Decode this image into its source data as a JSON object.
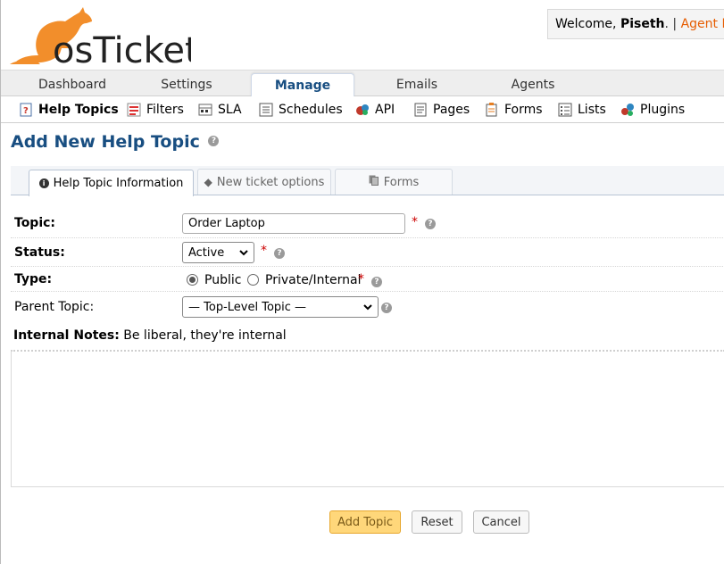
{
  "header": {
    "logo_text": "osTicket",
    "welcome_prefix": "Welcome,",
    "username": "Piseth",
    "separator": ". |",
    "agent_panel_link": "Agent Panel"
  },
  "main_nav": {
    "tabs": [
      {
        "label": "Dashboard",
        "active": false
      },
      {
        "label": "Settings",
        "active": false
      },
      {
        "label": "Manage",
        "active": true
      },
      {
        "label": "Emails",
        "active": false
      },
      {
        "label": "Agents",
        "active": false
      }
    ]
  },
  "sub_nav": {
    "items": [
      {
        "label": "Help Topics",
        "icon": "help-topics-icon",
        "active": true
      },
      {
        "label": "Filters",
        "icon": "filters-icon",
        "active": false
      },
      {
        "label": "SLA",
        "icon": "sla-icon",
        "active": false
      },
      {
        "label": "Schedules",
        "icon": "schedules-icon",
        "active": false
      },
      {
        "label": "API",
        "icon": "api-icon",
        "active": false
      },
      {
        "label": "Pages",
        "icon": "pages-icon",
        "active": false
      },
      {
        "label": "Forms",
        "icon": "forms-icon",
        "active": false
      },
      {
        "label": "Lists",
        "icon": "lists-icon",
        "active": false
      },
      {
        "label": "Plugins",
        "icon": "plugins-icon",
        "active": false
      }
    ]
  },
  "page": {
    "title": "Add New Help Topic",
    "help_glyph": "?"
  },
  "form_tabs": [
    {
      "label": "Help Topic Information",
      "icon": "info-icon",
      "active": true
    },
    {
      "label": "New ticket options",
      "icon": "tag-icon",
      "active": false
    },
    {
      "label": "Forms",
      "icon": "forms-tab-icon",
      "active": false
    }
  ],
  "form": {
    "topic": {
      "label": "Topic:",
      "value": "Order Laptop",
      "required_mark": "*"
    },
    "status": {
      "label": "Status:",
      "selected": "Active",
      "required_mark": "*"
    },
    "type": {
      "label": "Type:",
      "options": [
        {
          "label": "Public",
          "checked": true
        },
        {
          "label": "Private/Internal",
          "checked": false
        }
      ],
      "required_mark": "*"
    },
    "parent_topic": {
      "label": "Parent Topic:",
      "selected": "— Top-Level Topic —"
    },
    "internal_notes": {
      "label": "Internal Notes:",
      "hint": "Be liberal, they're internal",
      "value": ""
    }
  },
  "buttons": {
    "add": "Add Topic",
    "reset": "Reset",
    "cancel": "Cancel"
  },
  "colors": {
    "brand_orange": "#F28E2B",
    "title_blue": "#184E81",
    "primary_button": "#FFD77A",
    "required_red": "#CC0000"
  }
}
